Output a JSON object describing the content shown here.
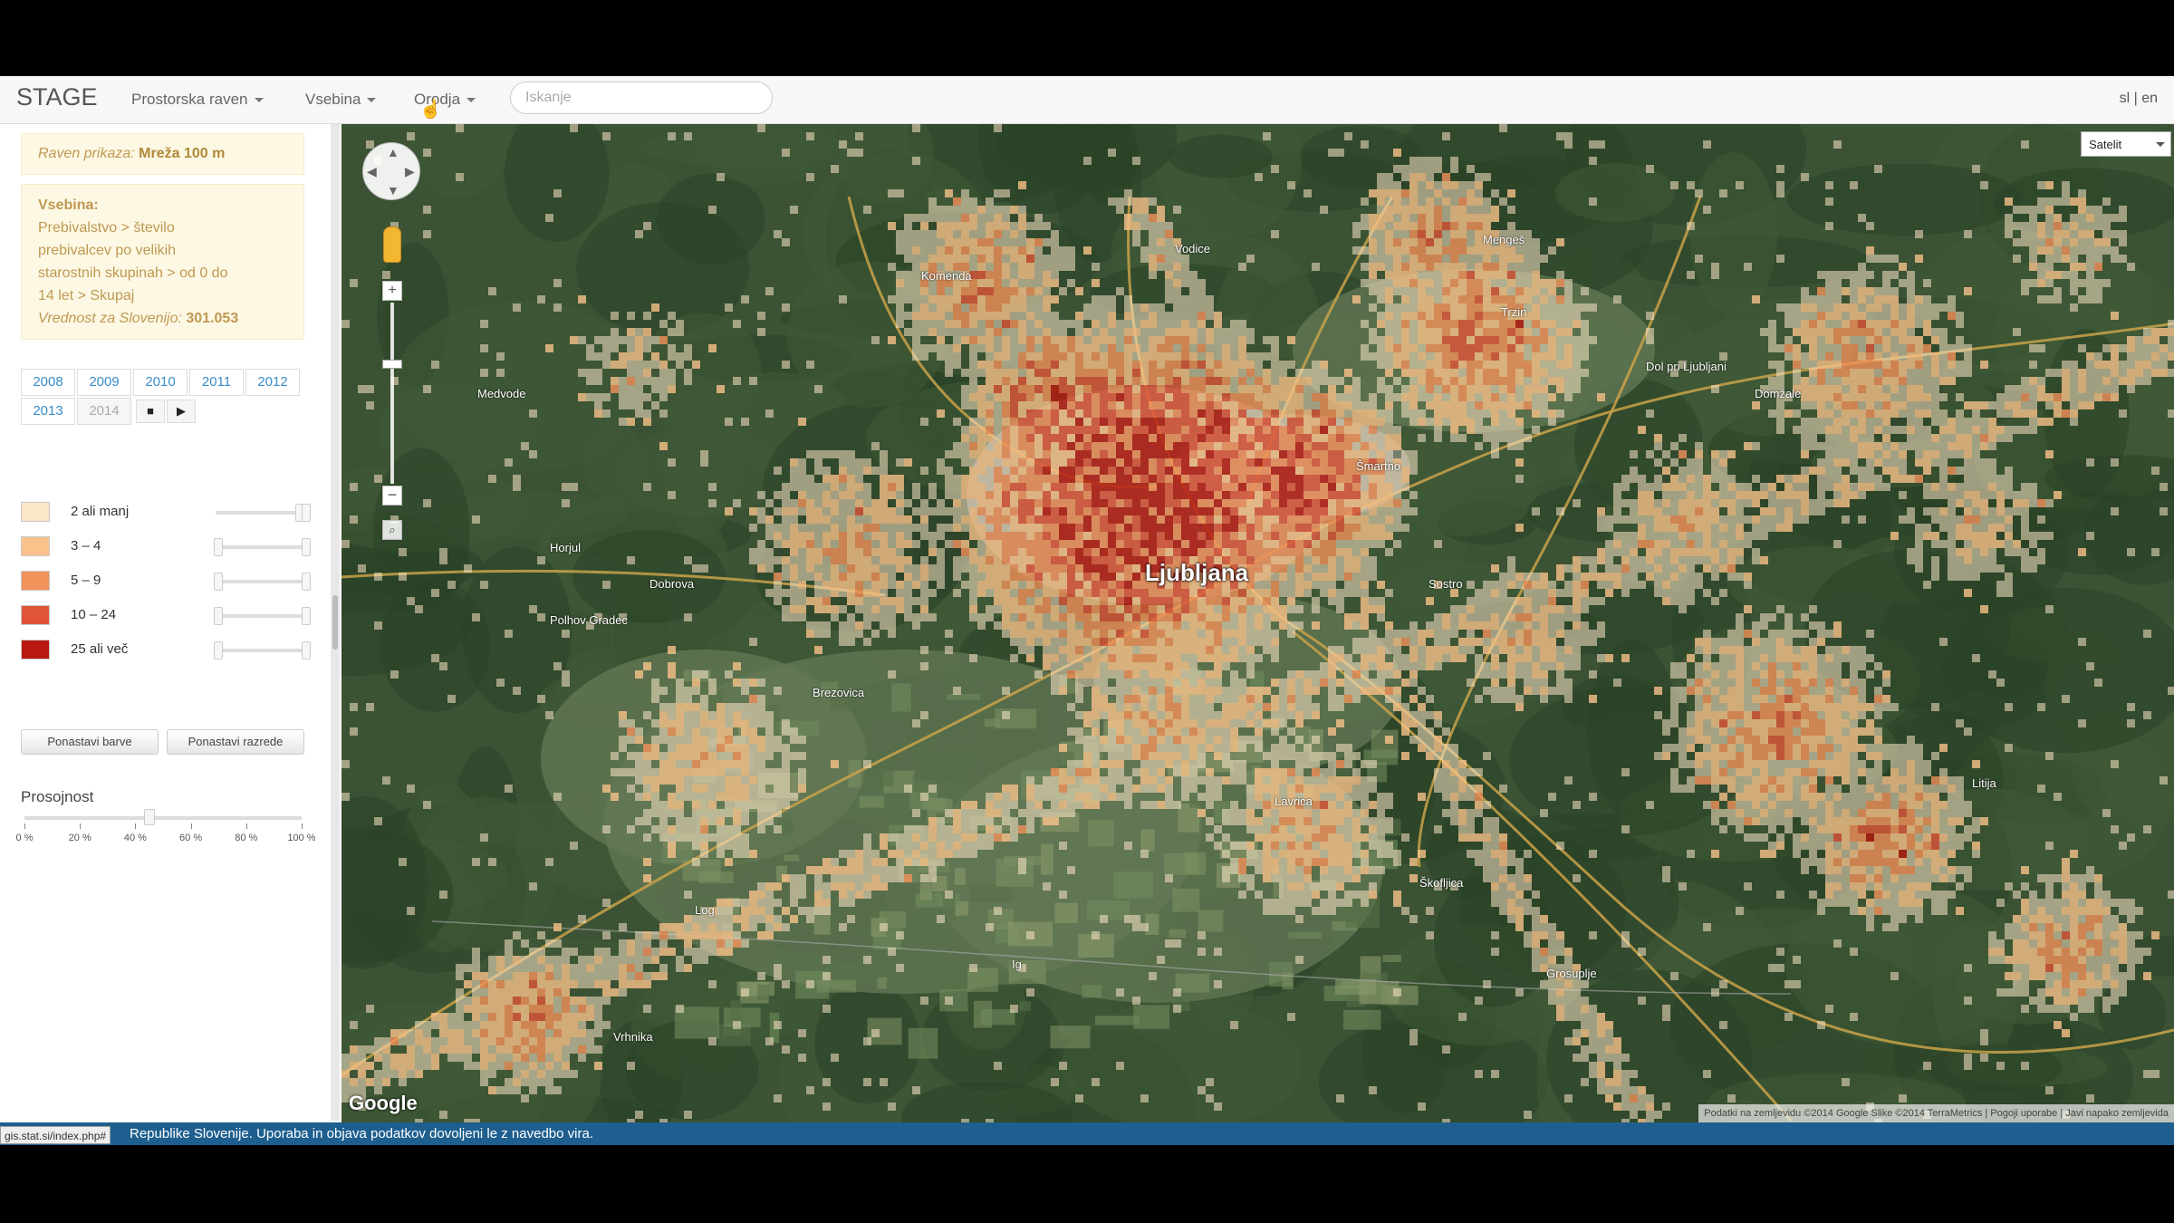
{
  "navbar": {
    "brand": "STAGE",
    "menus": [
      "Prostorska raven",
      "Vsebina",
      "Orodja"
    ],
    "search_placeholder": "Iskanje",
    "lang": "sl | en"
  },
  "sidebar": {
    "level_label": "Raven prikaza:",
    "level_value": "Mreža 100 m",
    "content_heading": "Vsebina:",
    "content_lines": [
      "Prebivalstvo > število",
      "prebivalcev po velikih",
      "starostnih skupinah > od 0 do",
      "14 let > Skupaj"
    ],
    "slovenia_label": "Vrednost za Slovenijo:",
    "slovenia_value": "301.053",
    "years": [
      "2008",
      "2009",
      "2010",
      "2011",
      "2012",
      "2013",
      "2014"
    ],
    "disabled_year": "2014",
    "stop_glyph": "■",
    "play_glyph": "▶",
    "legend": [
      {
        "label": "2 ali manj",
        "color": "#fbe6c8",
        "handle_left": 0.95
      },
      {
        "label": "3 – 4",
        "color": "#f8c28a",
        "handle_left": 0.0
      },
      {
        "label": "5 – 9",
        "color": "#f2915a",
        "handle_left": 0.0
      },
      {
        "label": "10 – 24",
        "color": "#e0553a",
        "handle_left": 0.0
      },
      {
        "label": "25 ali več",
        "color": "#b8180f",
        "handle_left": 0.0
      }
    ],
    "reset_colors": "Ponastavi barve",
    "reset_classes": "Ponastavi razrede",
    "opacity_label": "Prosojnost",
    "opacity_value": 0.45,
    "opacity_ticks": [
      "0 %",
      "20 %",
      "40 %",
      "60 %",
      "80 %",
      "100 %"
    ]
  },
  "map": {
    "maptype": "Satelit",
    "google": "Google",
    "attribution": "Podatki na zemljevidu ©2014 Google Slike ©2014 TerraMetrics | Pogoji uporabe | Javi napako zemljevida",
    "city": "Ljubljana",
    "places": [
      "Vodice",
      "Medvode",
      "Komenda",
      "Šmartno",
      "Dol pri Ljubljani",
      "Domžale",
      "Litija",
      "Grosuplje",
      "Škofljica",
      "Ig",
      "Vrhnika",
      "Horjul",
      "Brezovica",
      "Log",
      "Polhov Gradec",
      "Dobrova",
      "Lavrica",
      "Sostro",
      "Trzin",
      "Mengeš"
    ]
  },
  "footer": {
    "url": "gis.stat.si/index.php#",
    "text": "Republike Slovenije. Uporaba in objava podatkov dovoljeni le z navedbo vira."
  }
}
